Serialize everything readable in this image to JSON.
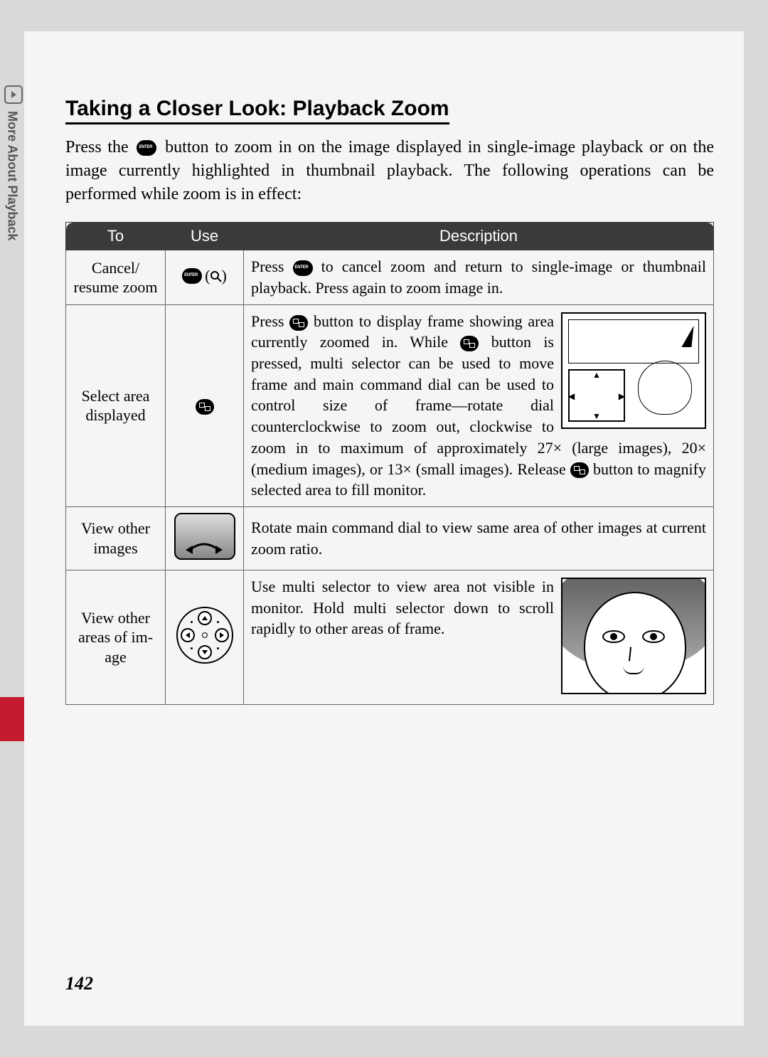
{
  "sidebar": {
    "section_label": "More About Playback"
  },
  "heading": "Taking a Closer Look: Playback Zoom",
  "intro": {
    "pre": "Press the ",
    "post": " button to zoom in on the image displayed in single-image play­back or on the image currently highlighted in thumbnail playback.  The fol­lowing operations can be performed while zoom is in effect:"
  },
  "table": {
    "headers": {
      "to": "To",
      "use": "Use",
      "desc": "Description"
    },
    "rows": [
      {
        "to": "Cancel/\nresume zoom",
        "use_icon": "enter-zoom",
        "desc_parts": [
          "Press ",
          " to cancel zoom and return to single-image or thumbnail playback.  Press again to zoom image in."
        ]
      },
      {
        "to": "Select area displayed",
        "use_icon": "thumb",
        "desc_parts": [
          "Press ",
          " button to display frame showing area currently zoomed in. While ",
          " button is pressed, multi selector can be used to move frame and main command dial can be used to control size of frame—rotate dial counterclockwise to zoom out, clockwise to zoom in to maximum of approximately 27× (large images), 20× (medium images), or 13× (small im­ages).  Release ",
          " button to magnify selected area to fill monitor."
        ],
        "has_image": true
      },
      {
        "to": "View other images",
        "use_icon": "dial",
        "desc": "Rotate main command dial to view same area of other im­ages at current zoom ratio."
      },
      {
        "to": "View other areas of im­age",
        "use_icon": "multiselector",
        "desc": "Use multi selector to view area not visible in monitor.  Hold multi se­lector down to scroll rapidly to other areas of frame.",
        "has_image": true
      }
    ]
  },
  "page_number": "142"
}
